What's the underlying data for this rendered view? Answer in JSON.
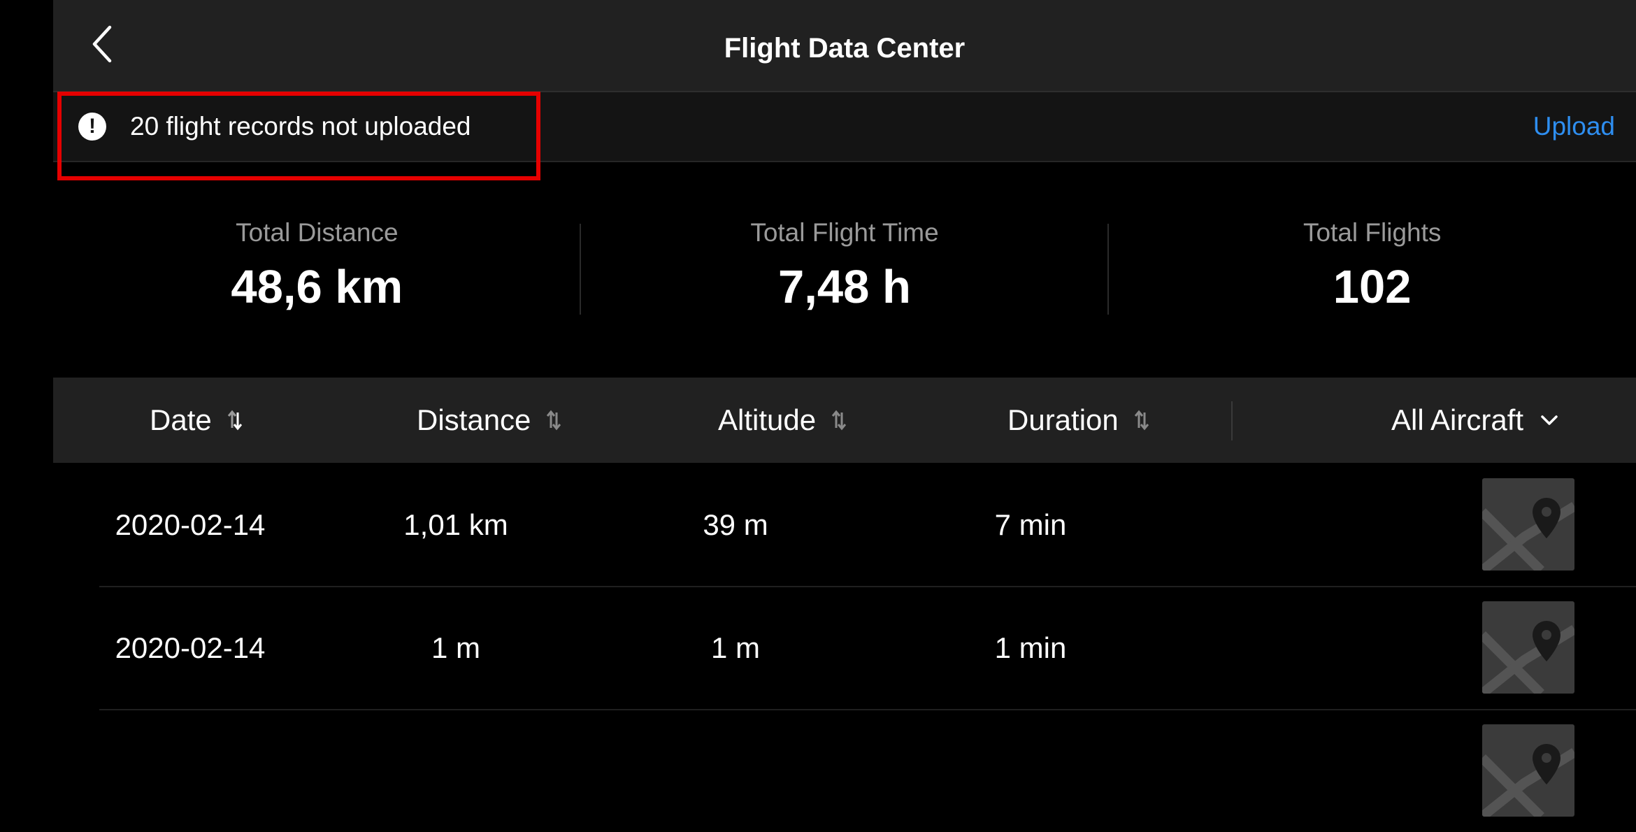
{
  "header": {
    "title": "Flight Data Center",
    "back_icon": "chevron-left-icon"
  },
  "notice": {
    "icon": "exclamation-circle-icon",
    "text": "20 flight records not uploaded",
    "action_label": "Upload",
    "highlight_color": "#e50000",
    "action_color": "#2e8ef0"
  },
  "stats": [
    {
      "label": "Total Distance",
      "value": "48,6 km"
    },
    {
      "label": "Total Flight Time",
      "value": "7,48 h"
    },
    {
      "label": "Total Flights",
      "value": "102"
    }
  ],
  "table": {
    "columns": [
      {
        "label": "Date",
        "sort_icon": "sort-active-icon"
      },
      {
        "label": "Distance",
        "sort_icon": "sort-icon"
      },
      {
        "label": "Altitude",
        "sort_icon": "sort-icon"
      },
      {
        "label": "Duration",
        "sort_icon": "sort-icon"
      }
    ],
    "filter": {
      "label": "All Aircraft",
      "icon": "chevron-down-icon"
    },
    "rows": [
      {
        "date": "2020-02-14",
        "distance": "1,01 km",
        "altitude": "39 m",
        "duration": "7 min",
        "thumb_icon": "map-pin-icon"
      },
      {
        "date": "2020-02-14",
        "distance": "1 m",
        "altitude": "1 m",
        "duration": "1 min",
        "thumb_icon": "map-pin-icon"
      },
      {
        "date": "",
        "distance": "",
        "altitude": "",
        "duration": "",
        "thumb_icon": "map-pin-icon"
      }
    ]
  }
}
